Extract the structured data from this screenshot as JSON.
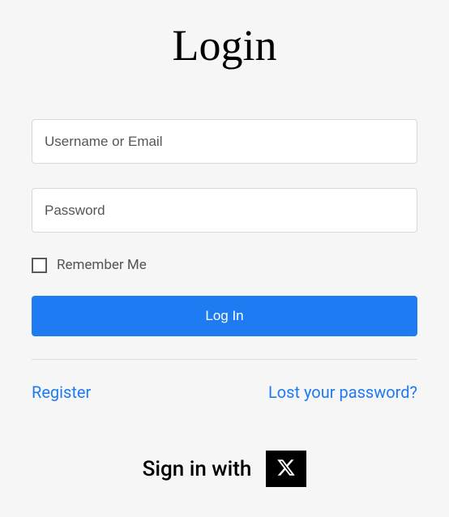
{
  "title": "Login",
  "form": {
    "username_placeholder": "Username or Email",
    "password_placeholder": "Password",
    "remember_label": "Remember Me",
    "submit_label": "Log In"
  },
  "links": {
    "register": "Register",
    "lost_password": "Lost your password?"
  },
  "social": {
    "signin_text": "Sign in with",
    "provider": "x-twitter"
  }
}
